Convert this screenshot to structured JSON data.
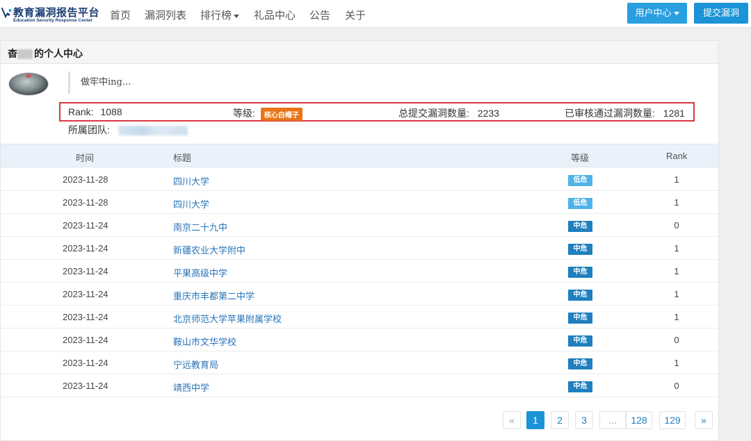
{
  "brand": {
    "title": "教育漏洞报告平台",
    "subtitle": "Education Security Response Center"
  },
  "nav": {
    "items": [
      {
        "label": "首页"
      },
      {
        "label": "漏洞列表"
      },
      {
        "label": "排行榜"
      },
      {
        "label": "礼品中心"
      },
      {
        "label": "公告"
      },
      {
        "label": "关于"
      }
    ],
    "user_center_label": "用户中心",
    "submit_label": "提交漏洞"
  },
  "profile": {
    "title_prefix": "杳",
    "title_suffix": "的个人中心",
    "motto": "做牢中ing...",
    "rank_label": "Rank:",
    "rank_value": "1088",
    "level_label": "等级:",
    "level_badge": "核心白帽子",
    "submitted_label": "总提交漏洞数量:",
    "submitted_value": "2233",
    "approved_label": "已审核通过漏洞数量:",
    "approved_value": "1281",
    "team_label": "所属团队:"
  },
  "table": {
    "headers": {
      "time": "时间",
      "title": "标题",
      "level": "等级",
      "rank": "Rank"
    },
    "rows": [
      {
        "date": "2023-11-28",
        "title": "四川大学",
        "level": "低危",
        "level_type": "low",
        "rank": "1"
      },
      {
        "date": "2023-11-28",
        "title": "四川大学",
        "level": "低危",
        "level_type": "low",
        "rank": "1"
      },
      {
        "date": "2023-11-24",
        "title": "南京二十九中",
        "level": "中危",
        "level_type": "mid",
        "rank": "0"
      },
      {
        "date": "2023-11-24",
        "title": "新疆农业大学附中",
        "level": "中危",
        "level_type": "mid",
        "rank": "1"
      },
      {
        "date": "2023-11-24",
        "title": "平果高级中学",
        "level": "中危",
        "level_type": "mid",
        "rank": "1"
      },
      {
        "date": "2023-11-24",
        "title": "重庆市丰都第二中学",
        "level": "中危",
        "level_type": "mid",
        "rank": "1"
      },
      {
        "date": "2023-11-24",
        "title": "北京师范大学苹果附属学校",
        "level": "中危",
        "level_type": "mid",
        "rank": "1"
      },
      {
        "date": "2023-11-24",
        "title": "鞍山市文华学校",
        "level": "中危",
        "level_type": "mid",
        "rank": "0"
      },
      {
        "date": "2023-11-24",
        "title": "宁远教育局",
        "level": "中危",
        "level_type": "mid",
        "rank": "1"
      },
      {
        "date": "2023-11-24",
        "title": "靖西中学",
        "level": "中危",
        "level_type": "mid",
        "rank": "0"
      }
    ]
  },
  "pagination": {
    "prev": "«",
    "pages": [
      "1",
      "2",
      "3",
      "...",
      "128",
      "129"
    ],
    "next": "»",
    "current": "1"
  },
  "colors": {
    "primary": "#1b93d6",
    "level_low": "#4fb3e8",
    "level_mid": "#1f7fbf",
    "badge_orange": "#e8751a",
    "highlight_border": "#d9363e",
    "link": "#2a74b8"
  },
  "icons": {
    "logo": "shield-wave-logo-icon",
    "dropdown": "caret-down-icon"
  }
}
